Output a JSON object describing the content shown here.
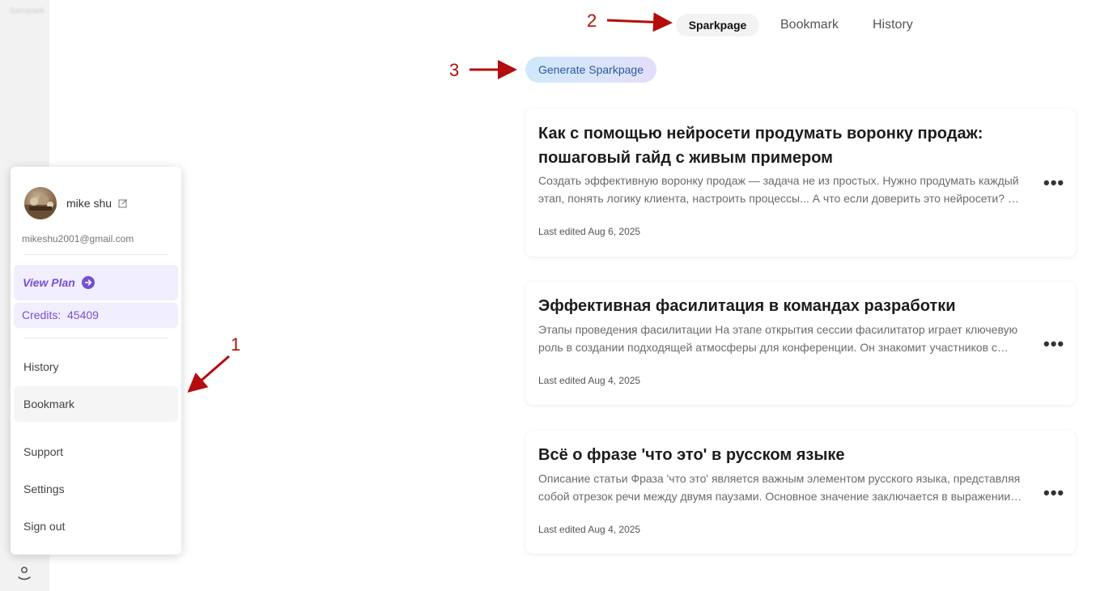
{
  "sidebar": {
    "logo_text": "Genspark",
    "user_icon": "user-icon"
  },
  "tabs": [
    {
      "label": "Sparkpage",
      "active": true
    },
    {
      "label": "Bookmark",
      "active": false
    },
    {
      "label": "History",
      "active": false
    }
  ],
  "generate_button": {
    "label": "Generate Sparkpage"
  },
  "annotations": [
    "1",
    "2",
    "3"
  ],
  "cards": [
    {
      "title": "Как с помощью нейросети продумать воронку продаж: пошаговый гайд с живым примером",
      "description": "Создать эффективную воронку продаж — задача не из простых. Нужно продумать каждый этап, понять логику клиента, настроить процессы... А что если доверить это нейросети? …",
      "date": "Last edited Aug 6, 2025"
    },
    {
      "title": "Эффективная фасилитация в командах разработки",
      "description": "Этапы проведения фасилитации На этапе открытия сессии фасилитатор играет ключевую роль в создании подходящей атмосферы для конференции. Он знакомит участников с…",
      "date": "Last edited Aug 4, 2025"
    },
    {
      "title": "Всё о фразе 'что это' в русском языке",
      "description": "Описание статьи Фраза 'что это' является важным элементом русского языка, представляя собой отрезок речи между двумя паузами. Основное значение заключается в выражении…",
      "date": "Last edited Aug 4, 2025"
    }
  ],
  "account_menu": {
    "username": "mike shu",
    "email": "mikeshu2001@gmail.com",
    "view_plan": "View Plan",
    "credits_label": "Credits:",
    "credits_value": "45409",
    "items": [
      "History",
      "Bookmark",
      "Support",
      "Settings",
      "Sign out"
    ]
  },
  "colors": {
    "accent": "#7450d6",
    "annotation": "#b40d0d",
    "sidebar": "#f2f2f2"
  }
}
